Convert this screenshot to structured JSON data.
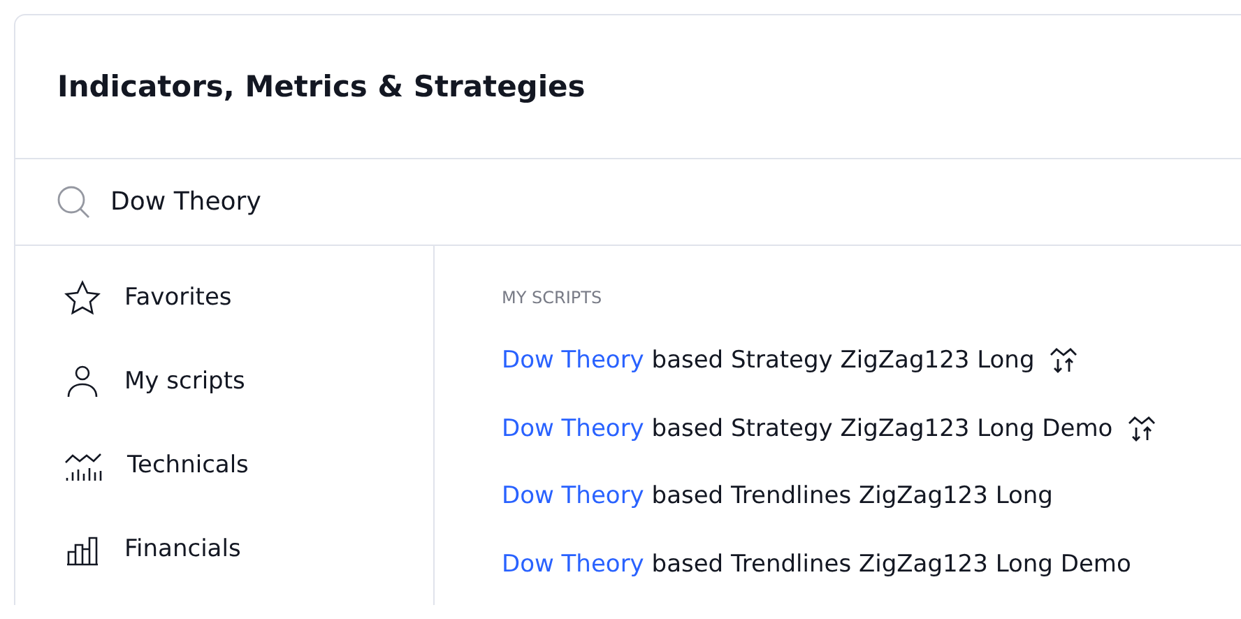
{
  "dialog": {
    "title": "Indicators, Metrics & Strategies"
  },
  "search": {
    "value": "Dow Theory"
  },
  "sidebar": {
    "items": [
      {
        "label": "Favorites",
        "kind": "star",
        "selected": false
      },
      {
        "label": "My scripts",
        "kind": "user",
        "selected": false
      },
      {
        "label": "Technicals",
        "kind": "technicals",
        "selected": false
      },
      {
        "label": "Financials",
        "kind": "financials",
        "selected": false
      }
    ]
  },
  "results": {
    "heading": "MY SCRIPTS",
    "items": [
      {
        "match": "Dow Theory",
        "rest": "based Strategy ZigZag123 Long",
        "kind": "strategy"
      },
      {
        "match": "Dow Theory",
        "rest": "based Strategy ZigZag123 Long Demo",
        "kind": "strategy"
      },
      {
        "match": "Dow Theory",
        "rest": "based Trendlines ZigZag123 Long",
        "kind": "indicator"
      },
      {
        "match": "Dow Theory",
        "rest": "based Trendlines ZigZag123 Long Demo",
        "kind": "indicator"
      }
    ]
  }
}
